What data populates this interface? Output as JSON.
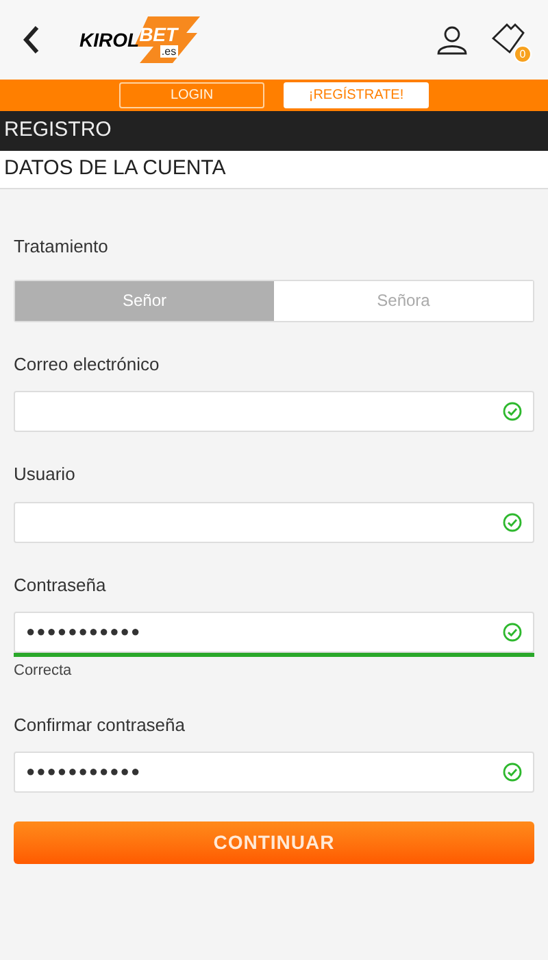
{
  "header": {
    "logo": {
      "part_1": "KIROL",
      "part_2": "BET",
      "suffix": ".es"
    },
    "betslip_count": "0"
  },
  "auth_bar": {
    "buttons": [
      {
        "label": "LOGIN",
        "kind": "outline"
      },
      {
        "label": "¡REGÍSTRATE!",
        "kind": "solid"
      }
    ]
  },
  "section_title": "REGISTRO",
  "subsection_title": "DATOS DE LA CUENTA",
  "form": {
    "salutation": {
      "label": "Tratamiento",
      "options": [
        {
          "label": "Señor",
          "selected": true
        },
        {
          "label": "Señora",
          "selected": false
        }
      ]
    },
    "fields": [
      {
        "label": "Correo electrónico",
        "valid": true,
        "kind": "blurred"
      },
      {
        "label": "Usuario",
        "valid": true,
        "kind": "blurred"
      },
      {
        "label": "Contraseña",
        "valid": true,
        "kind": "password",
        "value": "●●●●●●●●●●●",
        "strength": {
          "level": 1,
          "text": "Correcta"
        }
      },
      {
        "label": "Confirmar contraseña",
        "valid": true,
        "kind": "password",
        "value": "●●●●●●●●●●●"
      }
    ],
    "submit": "CONTINUAR"
  }
}
